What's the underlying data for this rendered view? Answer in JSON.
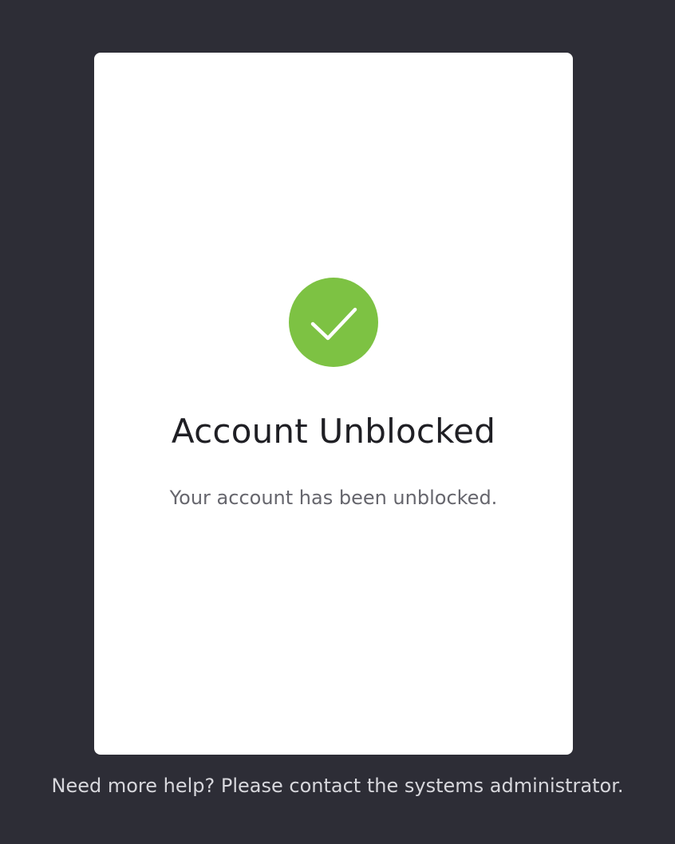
{
  "card": {
    "icon": "check-icon",
    "title": "Account Unblocked",
    "message": "Your account has been unblocked."
  },
  "footer": {
    "help_text": "Need more help? Please contact the systems administrator."
  },
  "colors": {
    "page_background": "#2d2d36",
    "card_background": "#ffffff",
    "success": "#7dc243",
    "title": "#1f1f24",
    "message": "#66666d",
    "footer_text": "#d7d7dc"
  }
}
